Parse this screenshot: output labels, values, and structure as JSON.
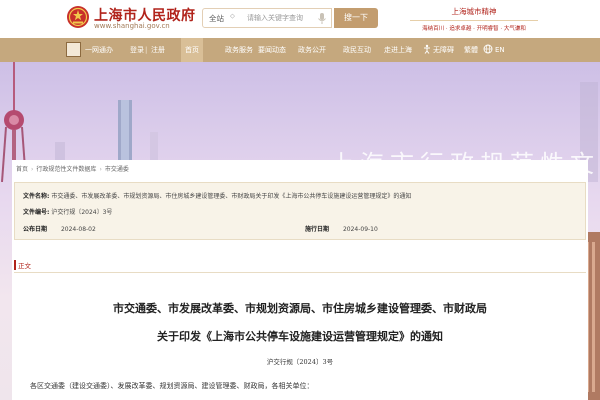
{
  "header": {
    "site_name": "上海市人民政府",
    "site_domain": "www.shanghai.gov.cn",
    "search_scope": "全站",
    "search_placeholder": "请输入关键字查询",
    "search_button": "搜一下",
    "slogan_title": "上海城市精神",
    "slogan_sub": "海纳百川 · 追求卓越 · 开明睿智 · 大气谦和"
  },
  "nav": {
    "items": [
      {
        "label": "一网通办"
      },
      {
        "label": "登录"
      },
      {
        "label": "注册"
      },
      {
        "label": "首页",
        "active": true
      },
      {
        "label": "政务服务"
      },
      {
        "label": "要闻动态"
      },
      {
        "label": "政务公开"
      },
      {
        "label": "政民互动"
      },
      {
        "label": "走进上海"
      },
      {
        "label": "无障碍"
      },
      {
        "label": "繁體"
      },
      {
        "label": "EN"
      }
    ],
    "sep": "|"
  },
  "banner": {
    "title": "上海市行政规范性文件管"
  },
  "breadcrumb": [
    "首页",
    "行政规范性文件数据库",
    "市交通委"
  ],
  "meta": {
    "issuer_label": "文件名称:",
    "issuer_value": "市交通委、市发展改革委、市规划资源局、市住房城乡建设管理委、市财政局关于印发《上海市公共停车设施建设运营管理规定》的通知",
    "docno_label": "文件编号:",
    "docno_value": "沪交行规〔2024〕3号",
    "publish_label": "公布日期",
    "publish_value": "2024-08-02",
    "effective_label": "施行日期",
    "effective_value": "2024-09-10"
  },
  "section": {
    "label": "正文"
  },
  "document": {
    "title_line1": "市交通委、市发展改革委、市规划资源局、市住房城乡建设管理委、市财政局",
    "title_line2": "关于印发《上海市公共停车设施建设运营管理规定》的通知",
    "doc_no": "沪交行规〔2024〕3号",
    "salutation": "各区交通委（建设交通委）、发展改革委、规划资源局、建设管理委、财政局，各相关单位："
  },
  "colors": {
    "brand_red": "#b1231b",
    "nav_gold": "#c5a87e",
    "search_btn": "#c39d6f"
  }
}
